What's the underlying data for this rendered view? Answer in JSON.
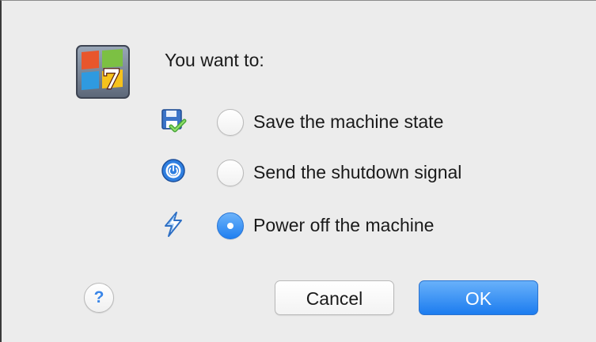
{
  "dialog": {
    "prompt": "You want to:",
    "os_icon": "windows-7-os-icon",
    "options": [
      {
        "label": "Save the machine state",
        "icon": "save-state-icon",
        "selected": false
      },
      {
        "label": "Send the shutdown signal",
        "icon": "power-button-icon",
        "selected": false
      },
      {
        "label": "Power off the machine",
        "icon": "lightning-bolt-icon",
        "selected": true
      }
    ],
    "help_label": "?",
    "cancel_label": "Cancel",
    "ok_label": "OK"
  },
  "colors": {
    "accent": "#1f7ff0",
    "dialog_bg": "#ececec",
    "text": "#1a1a1a"
  }
}
